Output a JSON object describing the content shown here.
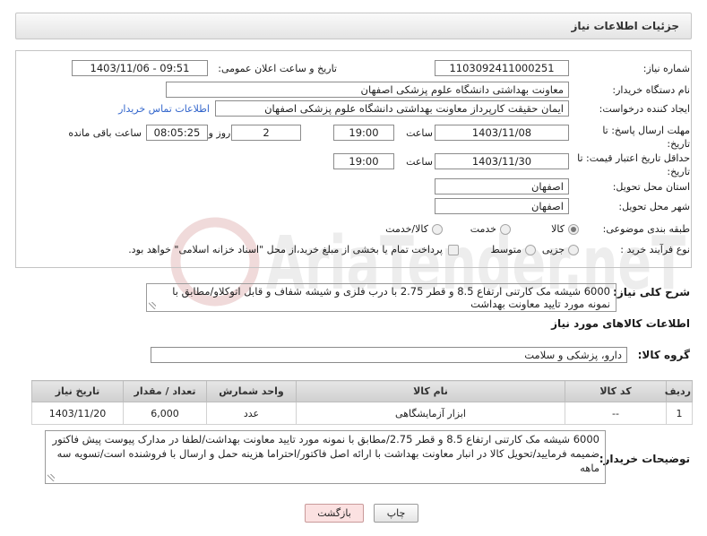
{
  "header": {
    "title": "جزئیات اطلاعات نیاز"
  },
  "watermark": "AriaTender.neT",
  "colors": {
    "link": "#3366cc",
    "back_button": "#fbe1e1"
  },
  "form": {
    "need_number": {
      "label": "شماره نیاز:",
      "value": "1103092411000251"
    },
    "announce": {
      "label": "تاریخ و ساعت اعلان عمومی:",
      "value": "1403/11/06 - 09:51"
    },
    "buyer_org": {
      "label": "نام دستگاه خریدار:",
      "value": "معاونت بهداشتی دانشگاه علوم پزشکی اصفهان"
    },
    "creator": {
      "label": "ایجاد کننده درخواست:",
      "value": "ایمان حقیقت کارپرداز معاونت بهداشتی دانشگاه علوم پزشکی اصفهان",
      "contact_link": "اطلاعات تماس خریدار"
    },
    "response_deadline": {
      "label_line1": "مهلت ارسال پاسخ: تا",
      "label_line2": "تاریخ:",
      "date": "1403/11/08",
      "time_label": "ساعت",
      "time": "19:00",
      "days": "2",
      "days_label": "روز و",
      "remaining": "08:05:25",
      "remaining_label": "ساعت باقی مانده"
    },
    "price_validity": {
      "label_line1": "حداقل تاریخ اعتبار قیمت: تا",
      "label_line2": "تاریخ:",
      "date": "1403/11/30",
      "time_label": "ساعت",
      "time": "19:00"
    },
    "province": {
      "label": "استان محل تحویل:",
      "value": "اصفهان"
    },
    "city": {
      "label": "شهر محل تحویل:",
      "value": "اصفهان"
    },
    "category": {
      "label": "طبقه بندی موضوعی:",
      "options": [
        "کالا",
        "خدمت",
        "کالا/خدمت"
      ],
      "selected": "کالا"
    },
    "process_type": {
      "label": "نوع فرآیند خرید :",
      "options": [
        "جزیی",
        "متوسط"
      ]
    },
    "treasury": {
      "label": "پرداخت تمام یا بخشی از مبلغ خرید،از محل \"اسناد خزانه اسلامی\" خواهد بود.",
      "checked": false
    }
  },
  "description": {
    "label": "شرح کلی نیاز:",
    "text": "6000 شیشه مک کارتنی ارتفاع 8.5 و قطر 2.75 با درب فلزی و شیشه شفاف و قابل اتوکلاو/مطابق با نمونه مورد تایید معاونت بهداشت"
  },
  "items": {
    "heading": "اطلاعات کالاهای مورد نیاز",
    "group_label": "گروه کالا:",
    "group_value": "دارو، پزشکی و سلامت",
    "columns": [
      "ردیف",
      "کد کالا",
      "نام کالا",
      "واحد شمارش",
      "تعداد / مقدار",
      "تاریخ نیاز"
    ],
    "rows": [
      [
        "1",
        "--",
        "ابزار آزمایشگاهی",
        "عدد",
        "6,000",
        "1403/11/20"
      ]
    ]
  },
  "buyer_notes": {
    "label": "توضیحات خریدار:",
    "text": "6000 شیشه مک کارتنی ارتفاع 8.5 و قطر 2.75/مطابق با نمونه مورد تایید معاونت بهداشت/لطفا در مدارک پیوست پیش فاکتور ضمیمه فرمایید/تحویل کالا در انبار معاونت بهداشت با ارائه اصل فاکتور/احتراما هزینه حمل و ارسال با فروشنده است/تسویه سه ماهه"
  },
  "buttons": {
    "print": "چاپ",
    "back": "بازگشت"
  }
}
